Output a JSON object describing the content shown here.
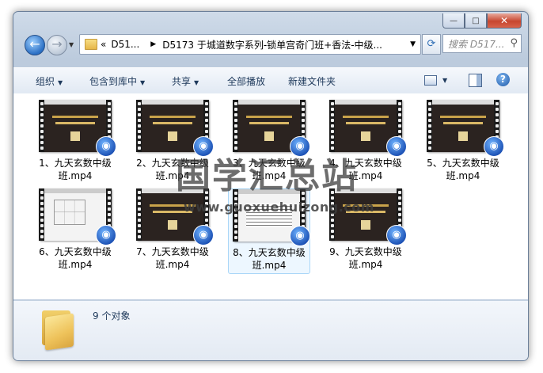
{
  "address": {
    "collapsed": "«",
    "crumb1": "D51...",
    "crumb2": "D5173 于城道数字系列-锁单宫奇门班+香法-中级...",
    "search_placeholder": "搜索 D517..."
  },
  "caption": {
    "min": "—",
    "max": "□",
    "close": "✕"
  },
  "toolbar": {
    "organize": "组织",
    "include": "包含到库中",
    "share": "共享",
    "play_all": "全部播放",
    "new_folder": "新建文件夹"
  },
  "files": [
    {
      "label": "1、九天玄数中级班.mp4",
      "thumb": "dark"
    },
    {
      "label": "2、九天玄数中级班.mp4",
      "thumb": "dark"
    },
    {
      "label": "3、九天玄数中级班.mp4",
      "thumb": "dark"
    },
    {
      "label": "4、九天玄数中级班.mp4",
      "thumb": "dark"
    },
    {
      "label": "5、九天玄数中级班.mp4",
      "thumb": "dark"
    },
    {
      "label": "6、九天玄数中级班.mp4",
      "thumb": "light-grid"
    },
    {
      "label": "7、九天玄数中级班.mp4",
      "thumb": "dark"
    },
    {
      "label": "8、九天玄数中级班.mp4",
      "thumb": "light-text",
      "selected": true
    },
    {
      "label": "9、九天玄数中级班.mp4",
      "thumb": "dark"
    }
  ],
  "status": {
    "count": "9 个对象"
  },
  "watermark": {
    "title": "国学汇总站",
    "url": "www.guoxuehuizong.com"
  },
  "colors": {
    "toolbar_text": "#1e395b",
    "selection": "#cce8ff"
  }
}
